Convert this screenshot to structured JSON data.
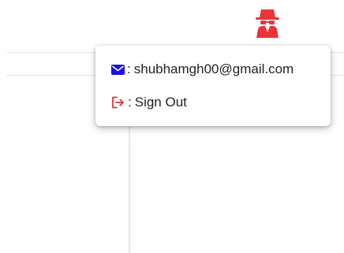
{
  "colors": {
    "accent_red": "#e8343a",
    "email_icon_blue": "#1a10e6",
    "text": "#222222"
  },
  "header": {
    "avatar_icon": "spy-incognito-icon"
  },
  "account_menu": {
    "email_icon": "envelope-icon",
    "separator": ":",
    "email": "shubhamgh00@gmail.com",
    "signout_icon": "sign-out-icon",
    "signout_label": "Sign Out"
  }
}
